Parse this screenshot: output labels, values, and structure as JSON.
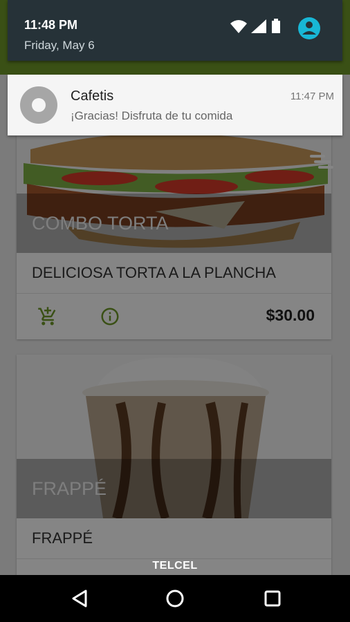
{
  "status": {
    "time": "11:48 PM",
    "date": "Friday, May 6"
  },
  "notification": {
    "app_name": "Cafetis",
    "message": "¡Gracias! Disfruta de tu comida",
    "time": "11:47 PM"
  },
  "products": [
    {
      "caption": "COMBO TORTA",
      "title": "DELICIOSA TORTA A LA PLANCHA",
      "price": "$30.00"
    },
    {
      "caption": "FRAPPÉ",
      "title": "FRAPPÉ"
    }
  ],
  "carrier": "TELCEL",
  "colors": {
    "accent": "#6f9a2a",
    "shade": "#263238",
    "avatar": "#18b7d6"
  },
  "icons": [
    "wifi-icon",
    "signal-icon",
    "battery-icon",
    "account-icon",
    "add-to-cart-icon",
    "info-icon",
    "menu-icon",
    "back-icon",
    "home-icon",
    "recents-icon"
  ]
}
